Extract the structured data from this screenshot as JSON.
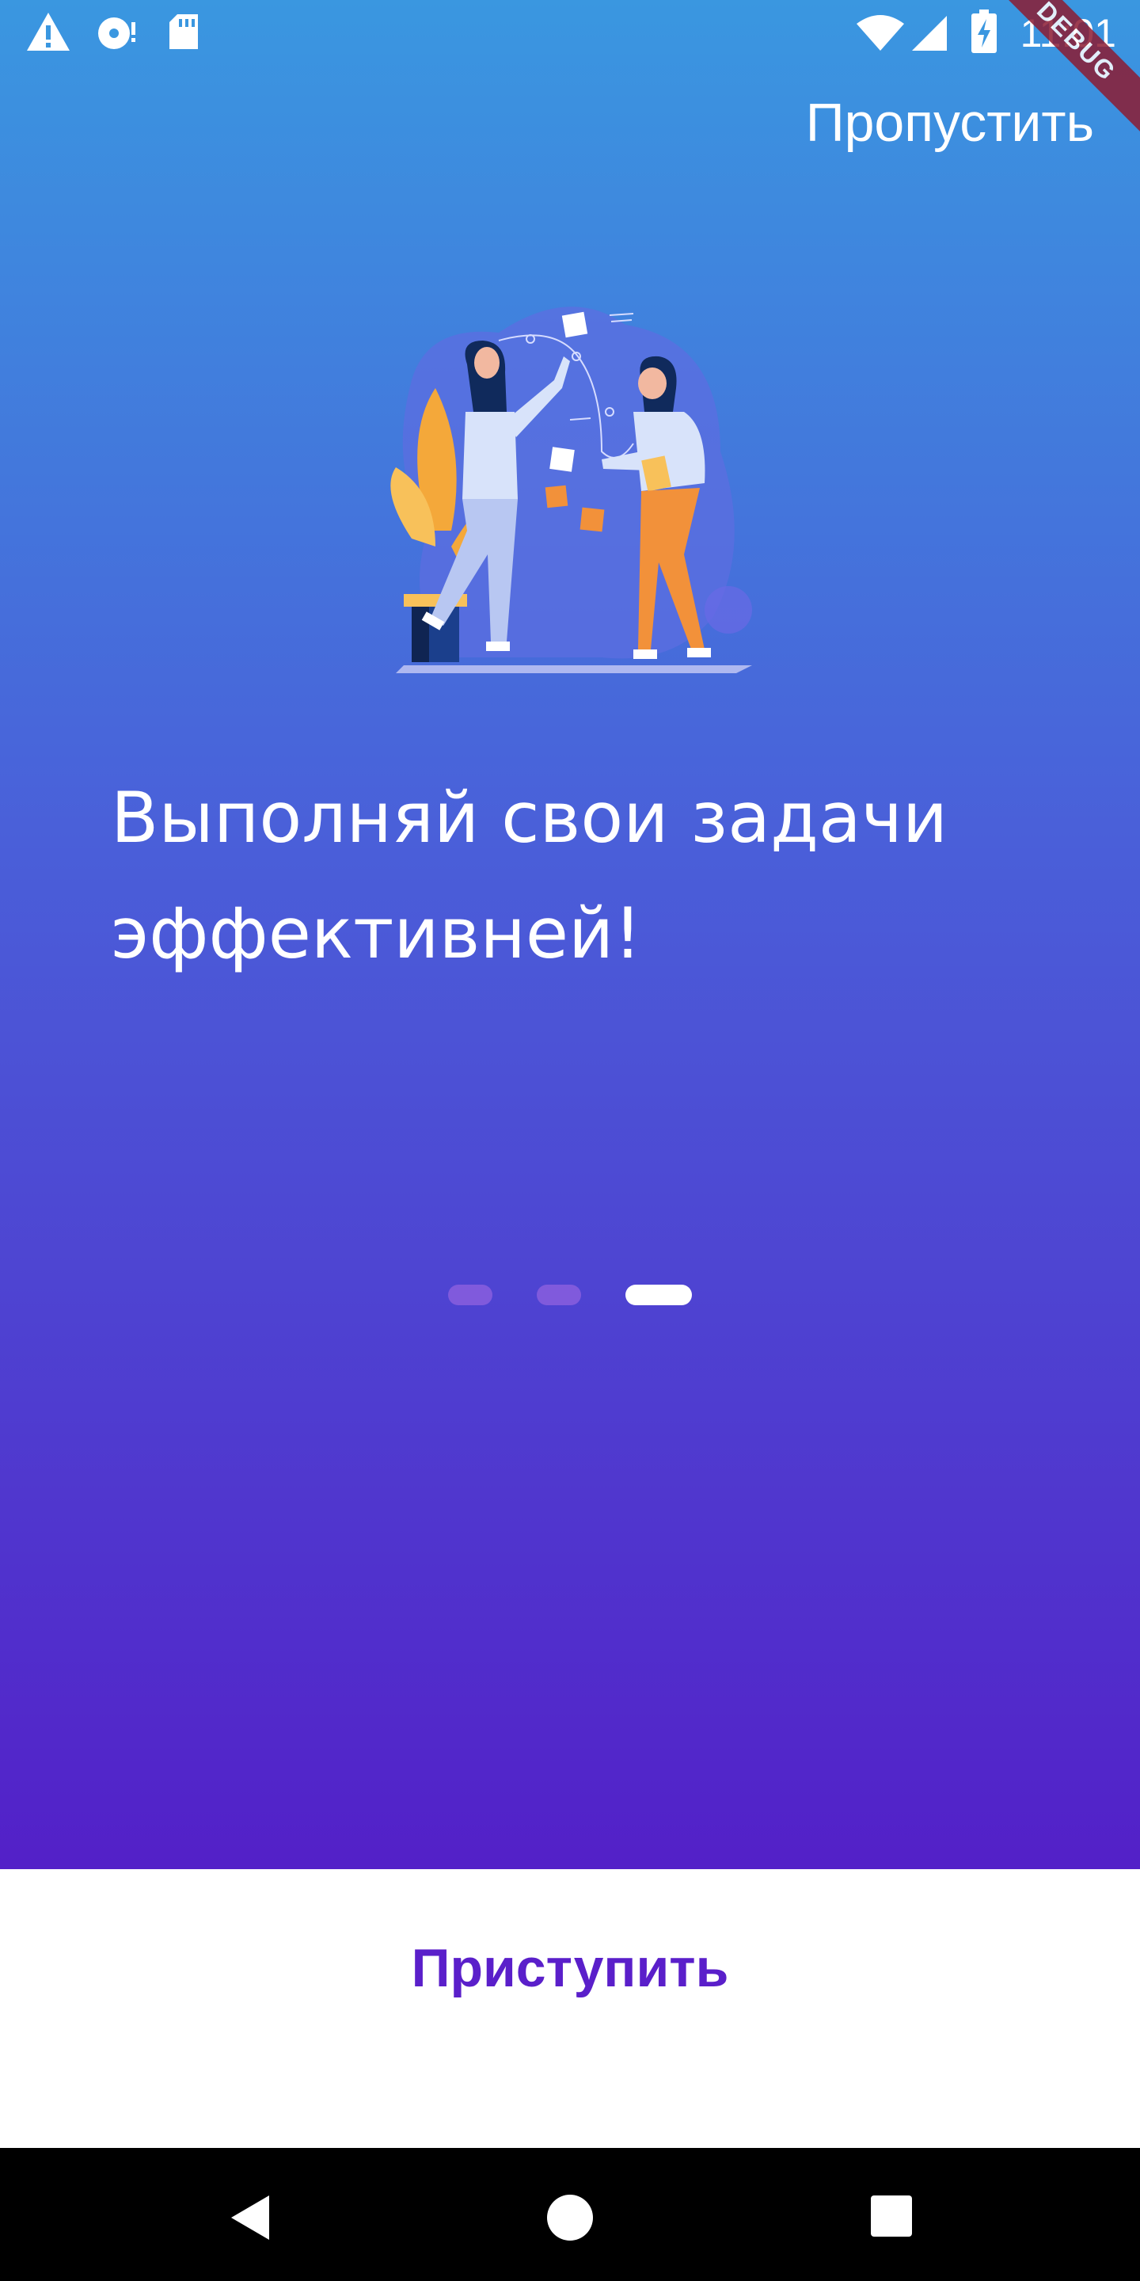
{
  "colors": {
    "gradient_top": "#3a97e0",
    "gradient_bottom": "#5320c8",
    "accent": "#5a1fca",
    "debug_ribbon": "#8c1c33"
  },
  "status_bar": {
    "time": "11:01",
    "left_icons": [
      "warning-icon",
      "disc-icon",
      "sd-card-icon"
    ],
    "right_icons": [
      "wifi-icon",
      "signal-icon",
      "battery-charging-icon"
    ]
  },
  "debug_banner": {
    "label": "DEBUG"
  },
  "header": {
    "skip_label": "Пропустить"
  },
  "onboarding": {
    "illustration": "team-task-board-illustration",
    "headline": "Выполняй свои задачи эффективней!",
    "page_indicator": {
      "pages": 3,
      "current": 3
    }
  },
  "footer": {
    "start_label": "Приступить"
  },
  "nav_bar": {
    "buttons": [
      "back-icon",
      "home-icon",
      "recents-icon"
    ]
  }
}
